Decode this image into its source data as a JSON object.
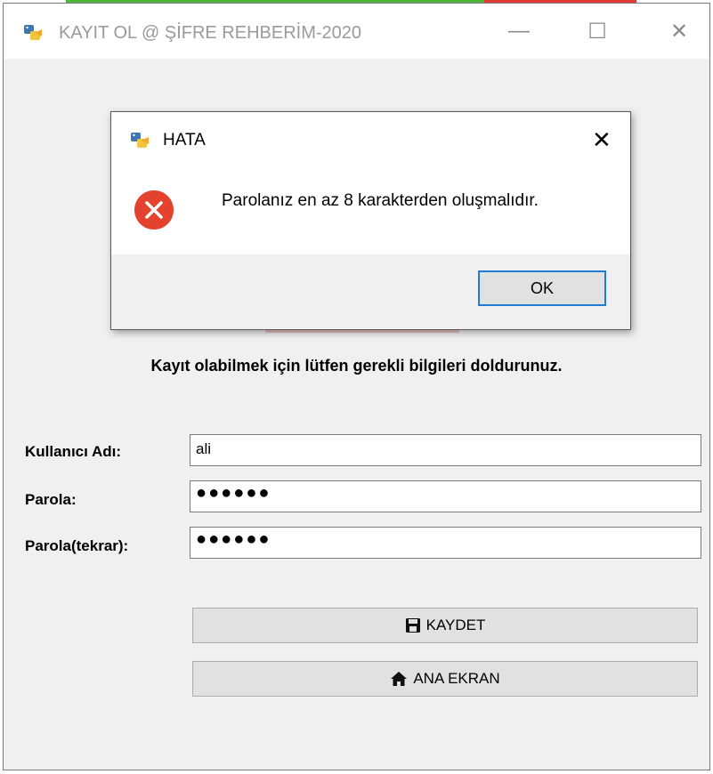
{
  "window": {
    "title": "KAYIT OL @ ŞİFRE REHBERİM-2020",
    "minimize_glyph": "—",
    "maximize_glyph": "☐",
    "close_glyph": "✕"
  },
  "form": {
    "heading": "Kayıt olabilmek için lütfen gerekli bilgileri doldurunuz.",
    "username_label": "Kullanıcı Adı:",
    "username_value": "ali",
    "password_label": "Parola:",
    "password_value": "●●●●●●",
    "password_repeat_label": "Parola(tekrar):",
    "password_repeat_value": "●●●●●●",
    "save_button": "KAYDET",
    "home_button": "ANA EKRAN"
  },
  "dialog": {
    "title": "HATA",
    "message": "Parolanız en az 8 karakterden oluşmalıdır.",
    "ok_button": "OK",
    "close_glyph": "✕"
  },
  "icons": {
    "app": "python-app-icon",
    "error": "error-icon",
    "save": "floppy-disk-icon",
    "home": "home-icon"
  },
  "colors": {
    "error_red": "#e2422e",
    "focus_blue": "#1f7bd4",
    "accent_green": "#4fb83a",
    "accent_red": "#e03a35"
  }
}
